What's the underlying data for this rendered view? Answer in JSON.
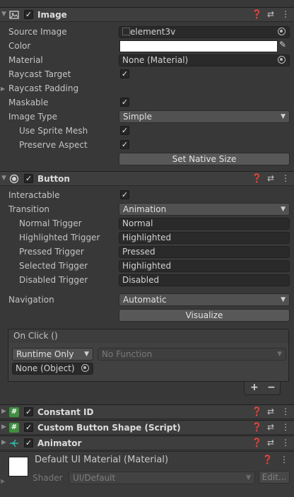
{
  "image": {
    "title": "Image",
    "props": [
      {
        "label": "Source Image",
        "value": "element3v"
      },
      {
        "label": "Color",
        "value": ""
      },
      {
        "label": "Material",
        "value": "None (Material)"
      },
      {
        "label": "Raycast Target",
        "checked": true
      },
      {
        "label": "Raycast Padding"
      },
      {
        "label": "Maskable",
        "checked": true
      },
      {
        "label": "Image Type",
        "value": "Simple"
      },
      {
        "label": "Use Sprite Mesh",
        "checked": true
      },
      {
        "label": "Preserve Aspect",
        "checked": true
      }
    ],
    "set_native_size": "Set Native Size"
  },
  "button": {
    "title": "Button",
    "interactable_label": "Interactable",
    "transition_label": "Transition",
    "transition_value": "Animation",
    "triggers": [
      {
        "label": "Normal Trigger",
        "value": "Normal"
      },
      {
        "label": "Highlighted Trigger",
        "value": "Highlighted"
      },
      {
        "label": "Pressed Trigger",
        "value": "Pressed"
      },
      {
        "label": "Selected Trigger",
        "value": "Highlighted"
      },
      {
        "label": "Disabled Trigger",
        "value": "Disabled"
      }
    ],
    "navigation_label": "Navigation",
    "navigation_value": "Automatic",
    "visualize": "Visualize",
    "onclick_title": "On Click ()",
    "runtime_value": "Runtime Only",
    "function_value": "No Function",
    "object_value": "None (Object)",
    "add": "+",
    "remove": "−"
  },
  "components": [
    {
      "title": "Constant ID"
    },
    {
      "title": "Custom Button Shape (Script)"
    },
    {
      "title": "Animator"
    }
  ],
  "material": {
    "name": "Default UI Material (Material)",
    "shader_label": "Shader",
    "shader_value": "UI/Default",
    "edit": "Edit..."
  },
  "colors": {
    "bg": "#383838",
    "header": "#3e3e3e",
    "field": "#2a2a2a",
    "script_green": "#3f8f3f"
  }
}
